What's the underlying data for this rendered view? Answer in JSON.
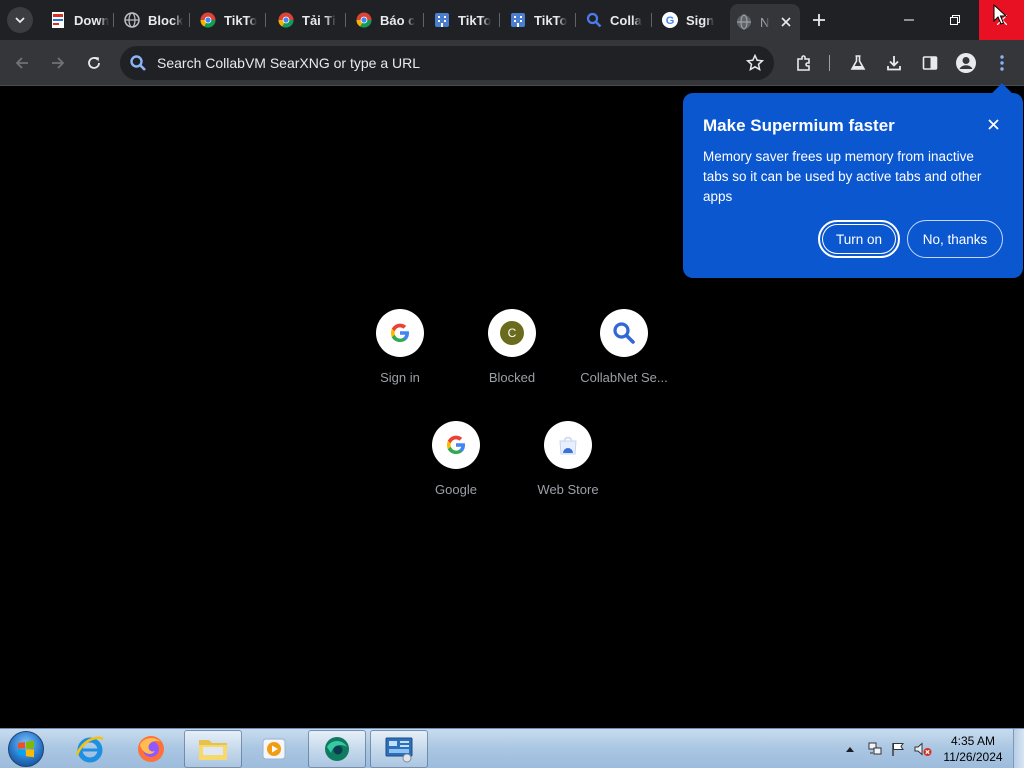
{
  "browser": {
    "tabs": [
      {
        "title": "Down",
        "icon": "pdf-favicon-icon"
      },
      {
        "title": "Block",
        "icon": "globe-icon"
      },
      {
        "title": "TikTo",
        "icon": "chrome-favicon-icon"
      },
      {
        "title": "Tải Ti",
        "icon": "chrome-favicon-icon"
      },
      {
        "title": "Báo c",
        "icon": "chrome-favicon-icon"
      },
      {
        "title": "TikTo",
        "icon": "building-favicon-icon"
      },
      {
        "title": "TikTo",
        "icon": "building-favicon-icon"
      },
      {
        "title": "Colla",
        "icon": "search-favicon-icon"
      },
      {
        "title": "Sign",
        "icon": "google-favicon-icon"
      },
      {
        "title": "N",
        "icon": "globe-icon"
      }
    ],
    "omnibox_placeholder": "Search CollabVM SearXNG or type a URL"
  },
  "shortcuts": [
    {
      "label": "Sign in",
      "icon": "google-g-icon"
    },
    {
      "label": "Blocked",
      "icon": "letter-avatar-icon",
      "letter": "C"
    },
    {
      "label": "CollabNet Se...",
      "icon": "magnifier-icon"
    },
    {
      "label": "Google",
      "icon": "google-g-icon"
    },
    {
      "label": "Web Store",
      "icon": "web-store-icon"
    }
  ],
  "bubble": {
    "title": "Make Supermium faster",
    "body": "Memory saver frees up memory from inactive tabs so it can be used by active tabs and other apps",
    "primary_label": "Turn on",
    "secondary_label": "No, thanks"
  },
  "taskbar": {
    "time": "4:35 AM",
    "date": "11/26/2024"
  },
  "colors": {
    "bubble": "#0b57d0",
    "tabstrip": "#202124",
    "toolbar": "#35363a",
    "close_red": "#e81123"
  }
}
